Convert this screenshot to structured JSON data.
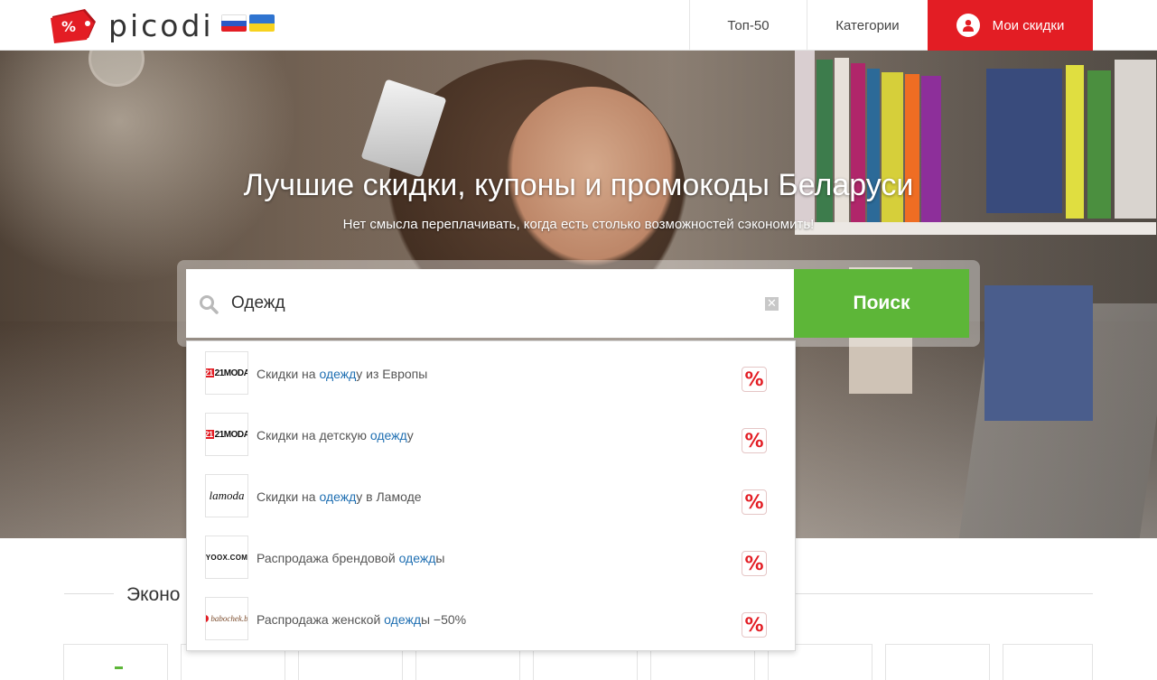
{
  "header": {
    "logo_text": "picodi",
    "logo_badge": "%",
    "flags": [
      {
        "name": "russia-flag",
        "colors": [
          "#ffffff",
          "#2a59c6",
          "#e31d24"
        ]
      },
      {
        "name": "ukraine-flag",
        "colors": [
          "#2f74d0",
          "#f7d21f"
        ]
      }
    ],
    "nav": {
      "top50": "Топ-50",
      "categories": "Категории",
      "my_discounts": "Мои скидки"
    }
  },
  "hero": {
    "title": "Лучшие скидки, купоны и промокоды Беларуси",
    "subtitle": "Нет смысла переплачивать, когда есть столько возможностей сэкономить!"
  },
  "search": {
    "value": "Одежд",
    "clear_symbol": "✕",
    "button_label": "Поиск"
  },
  "suggestions": [
    {
      "logo": "21MODA",
      "pre": "Скидки на ",
      "hl": "одежд",
      "post": "у из Европы",
      "badge": "%"
    },
    {
      "logo": "21MODA",
      "pre": "Скидки на детскую ",
      "hl": "одежд",
      "post": "у",
      "badge": "%"
    },
    {
      "logo": "lamoda",
      "pre": "Скидки на ",
      "hl": "одежд",
      "post": "у в Ламоде",
      "badge": "%"
    },
    {
      "logo": "YOOX.COM",
      "pre": "Распродажа брендовой ",
      "hl": "одежд",
      "post": "ы",
      "badge": "%"
    },
    {
      "logo": "babochek.by",
      "pre": "Распродажа женской ",
      "hl": "одежд",
      "post": "ы −50%",
      "badge": "%"
    }
  ],
  "section": {
    "title_visible": "Эконо"
  },
  "colors": {
    "brand_red": "#e31d24",
    "search_green": "#5db638",
    "highlight_blue": "#1f6fb2"
  }
}
